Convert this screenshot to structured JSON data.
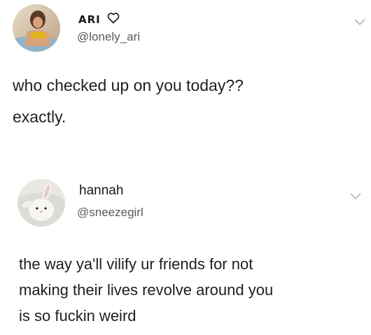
{
  "tweets": [
    {
      "display_name": "ARI",
      "name_icon": "heart-outline-icon",
      "handle": "@lonely_ari",
      "text_lines": [
        "who checked up on you today??",
        "exactly."
      ]
    },
    {
      "display_name": "hannah",
      "handle": "@sneezegirl",
      "text_lines": [
        "the way ya'll vilify ur friends for not",
        "making their lives revolve around you",
        "is so fuckin weird"
      ]
    }
  ],
  "colors": {
    "text": "#14171a",
    "handle": "#555a5f",
    "chevron": "#aab8c2"
  }
}
